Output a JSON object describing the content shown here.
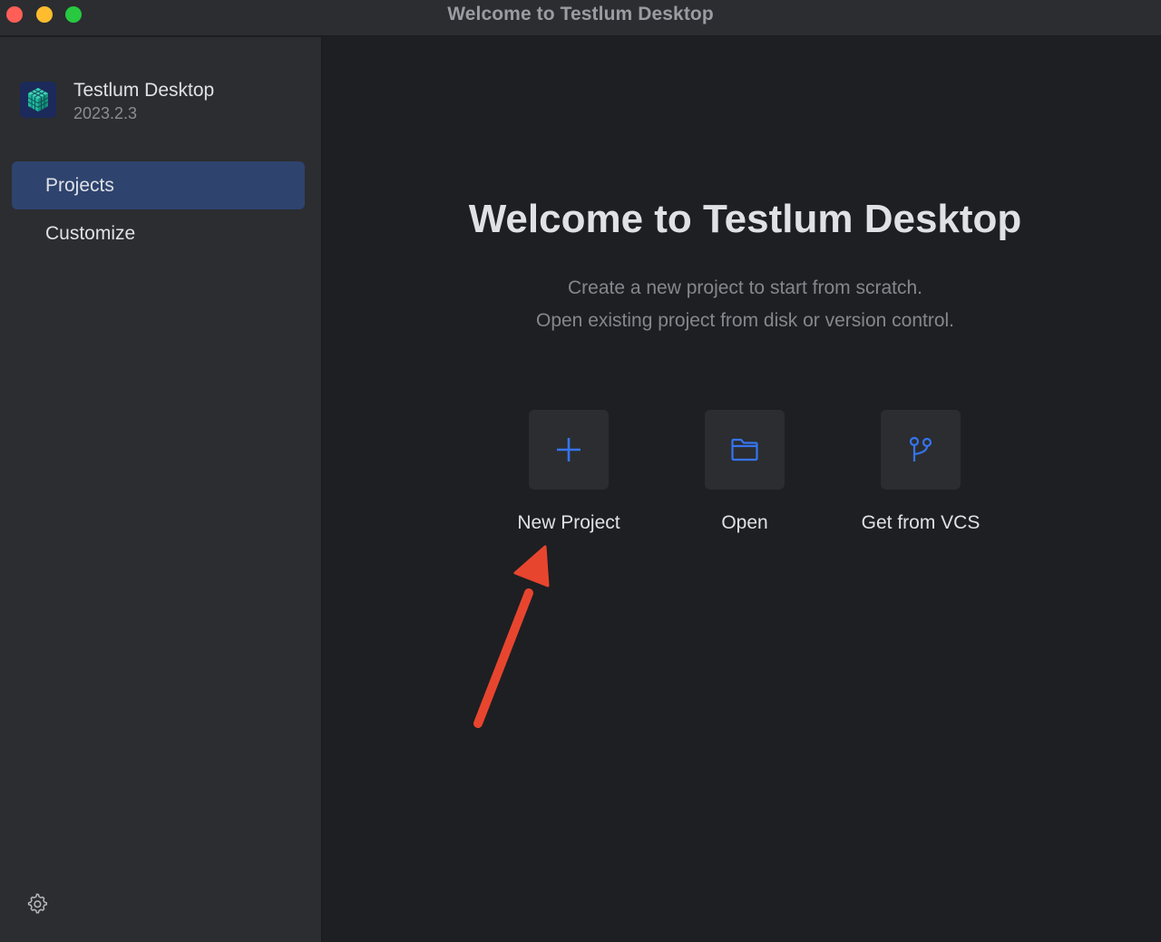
{
  "window": {
    "title": "Welcome to Testlum Desktop"
  },
  "sidebar": {
    "app_name": "Testlum Desktop",
    "app_version": "2023.2.3",
    "items": [
      {
        "label": "Projects",
        "selected": true
      },
      {
        "label": "Customize",
        "selected": false
      }
    ],
    "settings_icon": "gear-icon"
  },
  "main": {
    "title": "Welcome to Testlum Desktop",
    "subtitle_line1": "Create a new project to start from scratch.",
    "subtitle_line2": "Open existing project from disk or version control.",
    "actions": [
      {
        "label": "New Project",
        "icon": "plus-icon"
      },
      {
        "label": "Open",
        "icon": "folder-icon"
      },
      {
        "label": "Get from VCS",
        "icon": "vcs-branch-icon"
      }
    ]
  },
  "annotation": {
    "icon": "red-arrow-icon",
    "color": "#e8452f"
  },
  "colors": {
    "accent": "#3574f0",
    "selection": "#2e436e",
    "sidebar_bg": "#2b2d30",
    "main_bg": "#1e1f22"
  }
}
